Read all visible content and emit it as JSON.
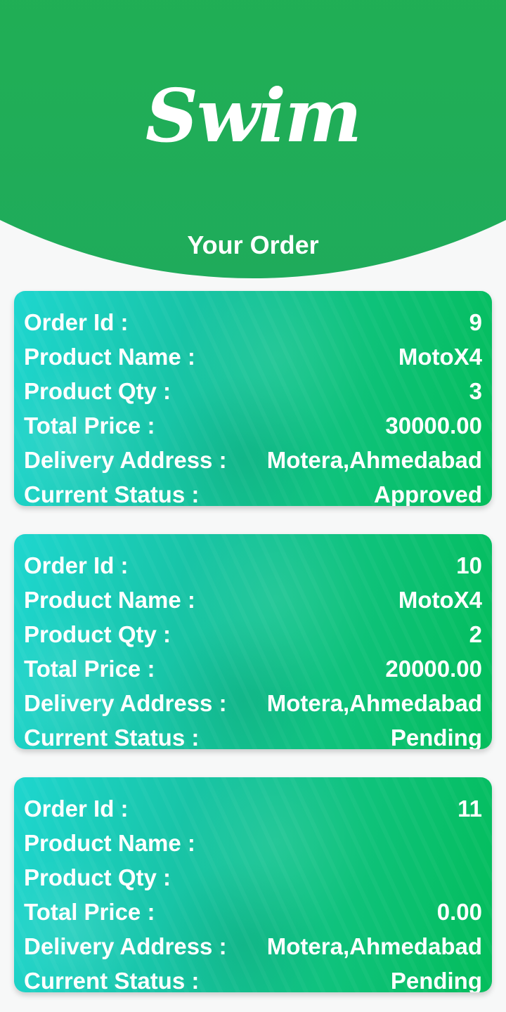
{
  "header": {
    "logo_text": "Swim",
    "title": "Your Order",
    "colors": {
      "header_green": "#22b24f",
      "card_start": "#1ed6cf",
      "card_end": "#03bd5b",
      "background": "#f7f8f8"
    }
  },
  "labels": {
    "order_id": "Order Id :",
    "product_name": "Product Name :",
    "product_qty": "Product Qty :",
    "total_price": "Total Price :",
    "delivery_address": "Delivery Address :",
    "current_status": "Current Status :"
  },
  "orders": [
    {
      "order_id": "9",
      "product_name": "MotoX4",
      "product_qty": "3",
      "total_price": "30000.00",
      "delivery_address": "Motera,Ahmedabad",
      "current_status": "Approved"
    },
    {
      "order_id": "10",
      "product_name": "MotoX4",
      "product_qty": "2",
      "total_price": "20000.00",
      "delivery_address": "Motera,Ahmedabad",
      "current_status": "Pending"
    },
    {
      "order_id": "11",
      "product_name": "",
      "product_qty": "",
      "total_price": "0.00",
      "delivery_address": "Motera,Ahmedabad",
      "current_status": "Pending"
    }
  ]
}
